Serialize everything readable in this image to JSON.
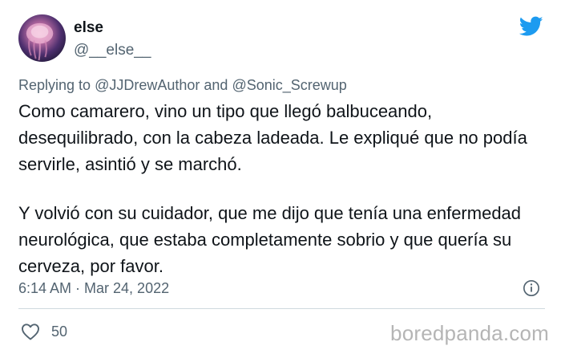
{
  "author": {
    "display_name": "else",
    "handle": "@__else__",
    "avatar": "jellyfish-avatar"
  },
  "brand": {
    "logo": "twitter-bird-icon",
    "color": "#1d9bf0"
  },
  "reply": {
    "prefix": "Replying to",
    "mention_1": "@JJDrewAuthor",
    "joiner": "and",
    "mention_2": "@Sonic_Screwup"
  },
  "tweet": {
    "paragraph_1": "Como camarero, vino un tipo que llegó balbuceando, desequilibrado, con la cabeza ladeada. Le expliqué que no podía servirle, asintió y se marchó.",
    "paragraph_2": "Y volvió con su cuidador, que me dijo que tenía una enfermedad neurológica, que estaba completamente sobrio y que quería su cerveza, por favor."
  },
  "meta": {
    "timestamp": "6:14 AM · Mar 24, 2022",
    "info_icon": "info-icon"
  },
  "actions": {
    "like_icon": "heart-icon",
    "like_count": "50"
  },
  "watermark": {
    "text": "boredpanda.com"
  },
  "colors": {
    "text": "#0f1419",
    "secondary": "#536471",
    "divider": "#cfd9de"
  }
}
